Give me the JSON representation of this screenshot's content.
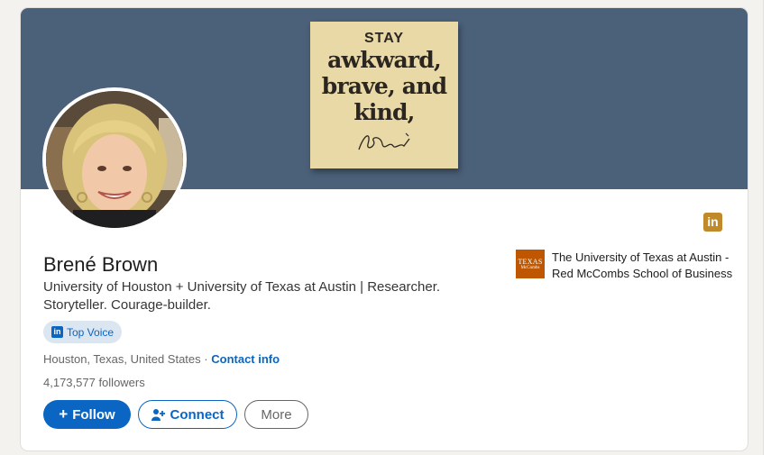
{
  "banner": {
    "note_line1": "STAY",
    "note_line2": "awkward,",
    "note_line3": "brave, and",
    "note_line4": "kind,"
  },
  "profile": {
    "name": "Brené Brown",
    "headline": "University of Houston + University of Texas at Austin | Researcher. Storyteller. Courage-builder.",
    "badge_label": "Top Voice",
    "location": "Houston, Texas, United States",
    "separator": "·",
    "contact_label": "Contact info",
    "followers": "4,173,577 followers"
  },
  "actions": {
    "follow_label": "Follow",
    "connect_label": "Connect",
    "more_label": "More"
  },
  "education": {
    "logo_line1": "TEXAS",
    "logo_line2": "McCombs",
    "name": "The University of Texas at Austin - Red McCombs School of Business"
  },
  "icons": {
    "linkedin_badge": "in",
    "follow": "+",
    "connect": "add-person"
  },
  "colors": {
    "accent": "#0a66c2",
    "banner": "#4b6079",
    "note": "#e9d9a6",
    "texas_orange": "#bf5700",
    "linkedin_gold": "#c08a2b"
  }
}
